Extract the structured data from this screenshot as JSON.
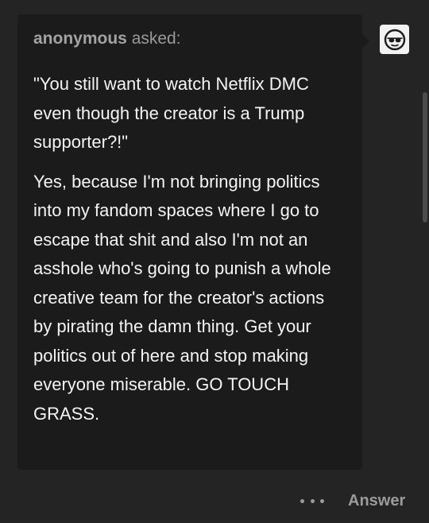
{
  "ask": {
    "asker_name": "anonymous",
    "asked_label": "asked:",
    "question": "\"You still want to watch Netflix DMC even though the creator is a Trump supporter?!\"",
    "answer": "Yes, because I'm not bringing politics into my fandom spaces where I go to escape that shit and also I'm not an asshole who's going to punish a whole creative team for the creator's actions by pirating the damn thing. Get your politics out of here and stop making everyone miserable. GO TOUCH GRASS."
  },
  "avatar": {
    "icon": "sunglasses-face-icon"
  },
  "footer": {
    "more_icon": "more-dots-icon",
    "answer_label": "Answer"
  },
  "colors": {
    "page_background": "#242424",
    "card_background": "#1b1b1b",
    "text_primary": "#f4f4f4",
    "text_muted": "#9a9a9a",
    "avatar_background": "#f2f2f2"
  }
}
